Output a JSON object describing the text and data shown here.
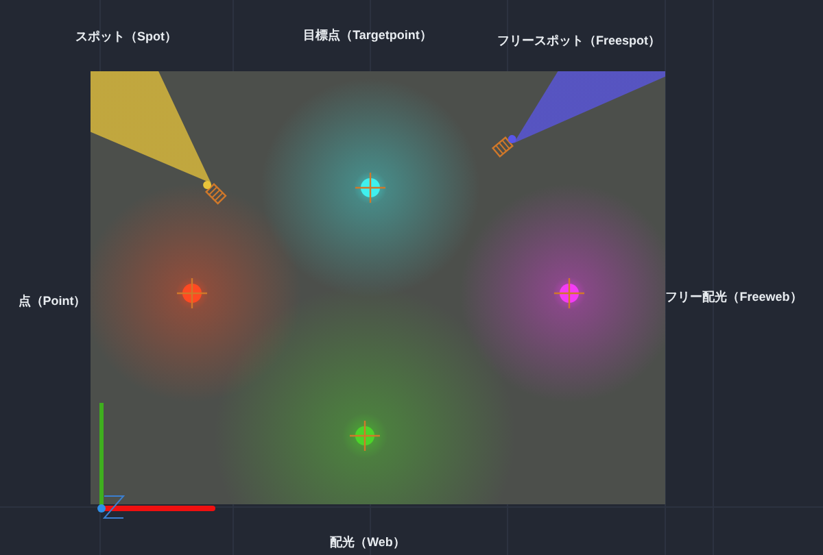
{
  "lights": [
    {
      "kind": "spot",
      "label": "スポット（Spot）",
      "color": "#e8c43a"
    },
    {
      "kind": "target",
      "label": "目標点（Targetpoint）",
      "color": "#3ff0ee"
    },
    {
      "kind": "freespot",
      "label": "フリースポット（Freespot）",
      "color": "#5a56e8"
    },
    {
      "kind": "point",
      "label": "点（Point）",
      "color": "#ff4a22"
    },
    {
      "kind": "freeweb",
      "label": "フリー配光（Freeweb）",
      "color": "#f43cf4"
    },
    {
      "kind": "web",
      "label": "配光（Web）",
      "color": "#4cd42a"
    }
  ]
}
